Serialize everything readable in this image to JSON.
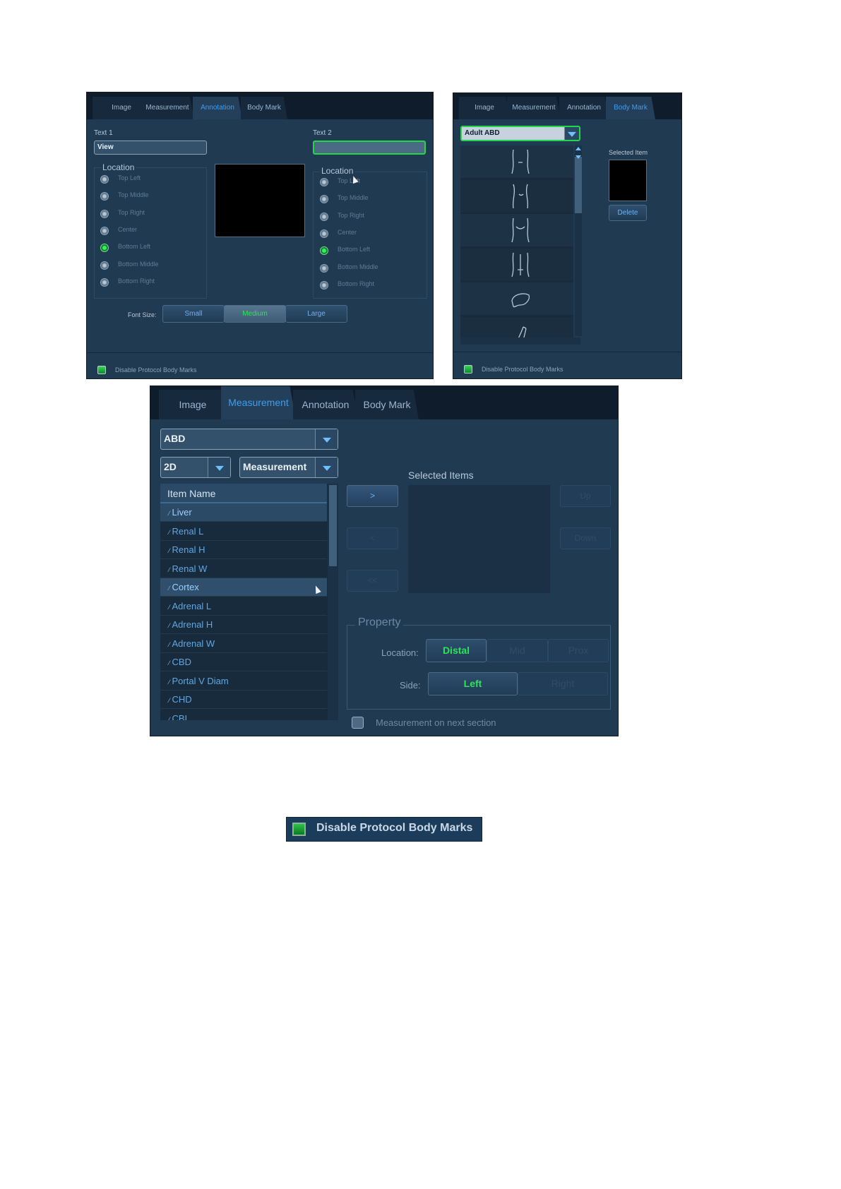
{
  "annotation_panel": {
    "tabs": [
      "Image",
      "Measurement",
      "Annotation",
      "Body Mark"
    ],
    "active_tab": "Annotation",
    "text1_label": "Text 1",
    "text1_value": "View",
    "text2_label": "Text 2",
    "text2_value": "",
    "location_label": "Location",
    "locations": [
      "Top Left",
      "Top Middle",
      "Top Right",
      "Center",
      "Bottom Left",
      "Bottom Middle",
      "Bottom Right"
    ],
    "selected_location": "Bottom Left",
    "location2_label": "Location",
    "locations2": [
      "Top Left",
      "Top Middle",
      "Top Right",
      "Center",
      "Bottom Left",
      "Bottom Middle",
      "Bottom Right"
    ],
    "selected_location2": "Bottom Left",
    "font_size_label": "Font Size:",
    "font_sizes": [
      "Small",
      "Medium",
      "Large"
    ],
    "selected_font_size": "Medium",
    "disable_label": "Disable Protocol Body Marks",
    "disable_checked": true
  },
  "bodymark_panel": {
    "tabs": [
      "Image",
      "Measurement",
      "Annotation",
      "Body Mark"
    ],
    "active_tab": "Body Mark",
    "dropdown_value": "Adult ABD",
    "selected_item_label": "Selected Item",
    "delete_label": "Delete",
    "thumbnails": [
      "torso-front-icon",
      "torso-side-icon",
      "torso-back-icon",
      "torso-spine-icon",
      "liver-icon",
      "leg-icon"
    ],
    "disable_label": "Disable Protocol Body Marks",
    "disable_checked": true
  },
  "measurement_panel": {
    "tabs": [
      "Image",
      "Measurement",
      "Annotation",
      "Body Mark"
    ],
    "active_tab": "Measurement",
    "exam_dropdown": "ABD",
    "mode_dropdown": "2D",
    "type_dropdown": "Measurement",
    "list_header": "Item Name",
    "items": [
      "Liver",
      "Renal L",
      "Renal H",
      "Renal W",
      "Cortex",
      "Adrenal L",
      "Adrenal H",
      "Adrenal W",
      "CBD",
      "Portal V Diam",
      "CHD",
      "CBL"
    ],
    "selected_items_label": "Selected Items",
    "btn_add": ">",
    "btn_remove": "<",
    "btn_remove_all": "<<",
    "btn_up": "Up",
    "btn_down": "Down",
    "property_label": "Property",
    "location_label": "Location:",
    "location_options": [
      "Distal",
      "Mid",
      "Prox"
    ],
    "selected_location": "Distal",
    "side_label": "Side:",
    "side_options": [
      "Left",
      "Right"
    ],
    "selected_side": "Left",
    "next_section_label": "Measurement on next section",
    "next_section_checked": false
  },
  "zoom_checkbox": {
    "label": "Disable Protocol Body Marks",
    "checked": true
  }
}
